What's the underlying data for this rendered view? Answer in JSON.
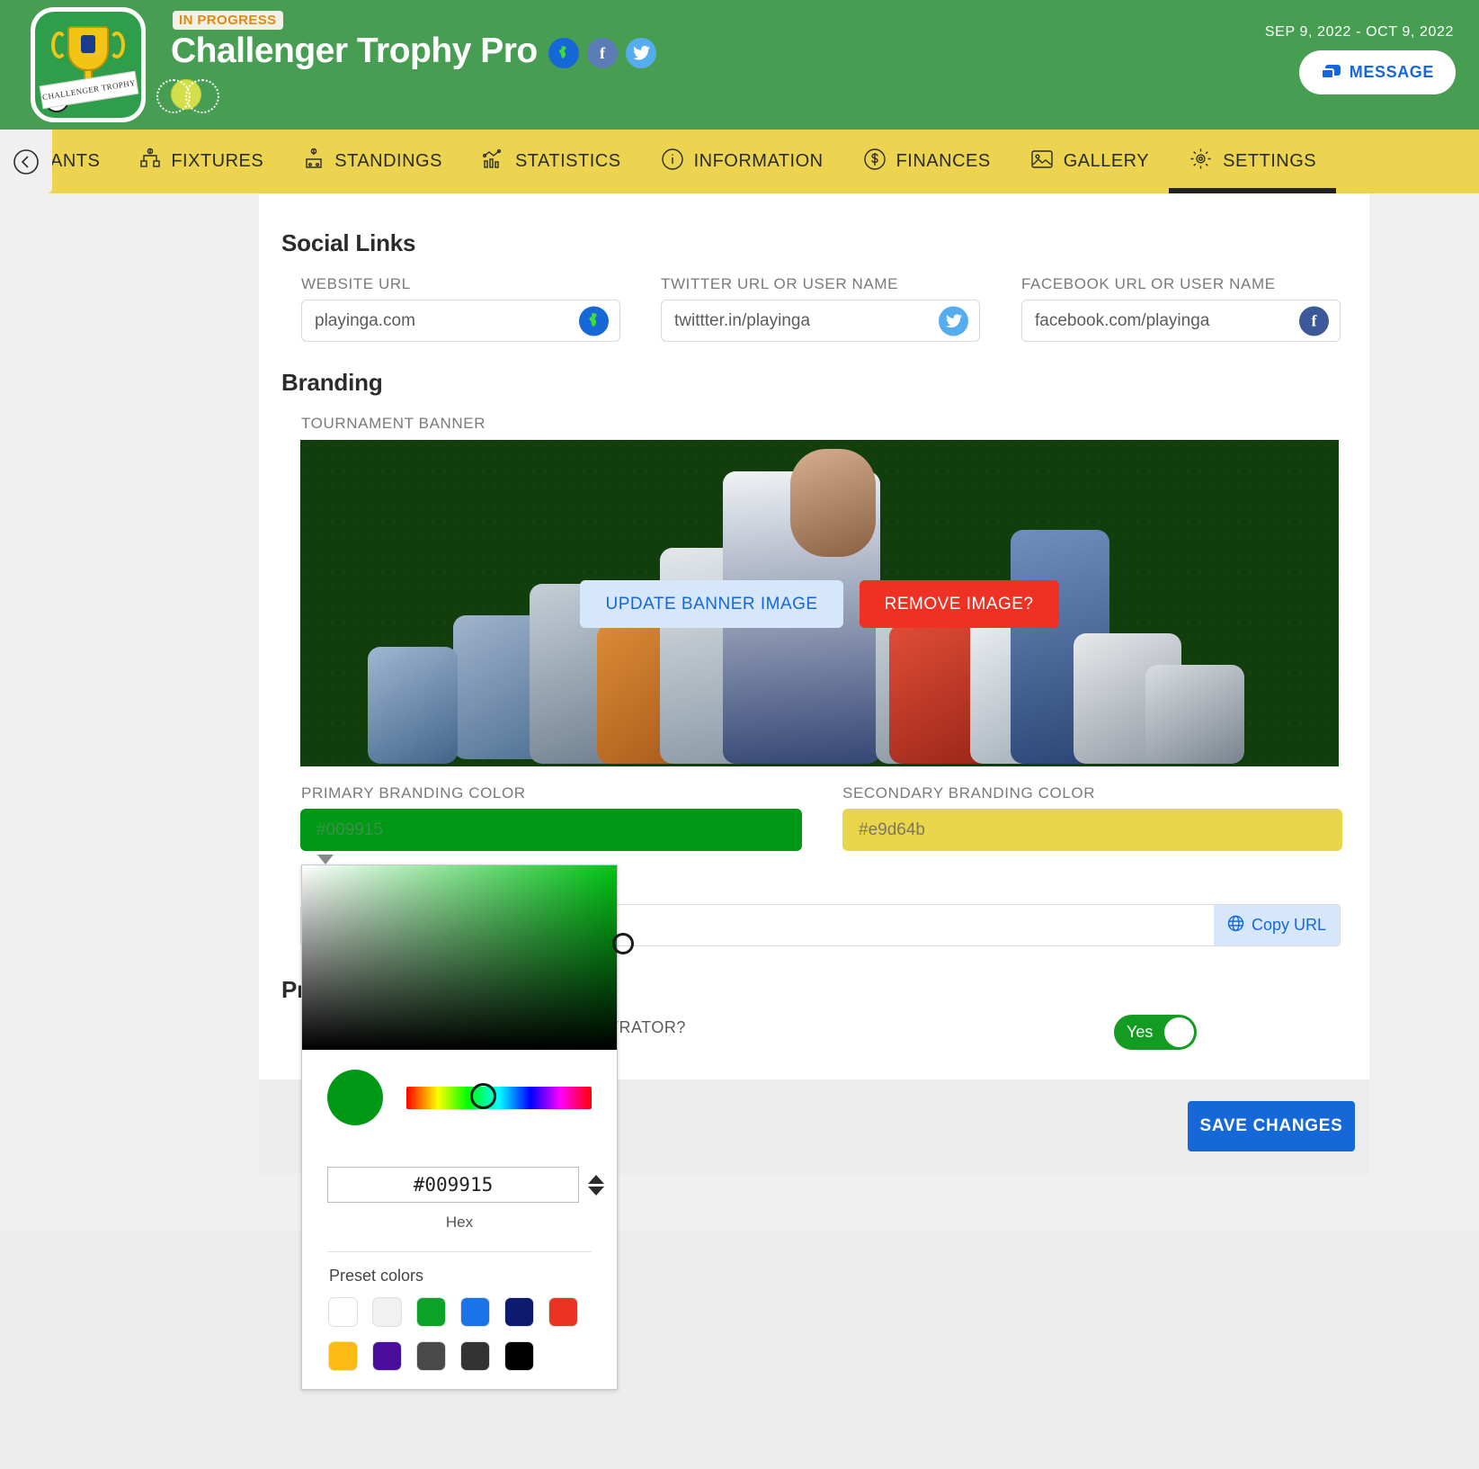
{
  "header": {
    "status_badge": "IN PROGRESS",
    "title": "Challenger Trophy Pro",
    "logo_ribbon_text": "CHALLENGER TROPHY",
    "date_range": "SEP 9, 2022 - OCT 9, 2022",
    "message_button": "MESSAGE",
    "social_icons": [
      "globe-icon",
      "facebook-icon",
      "twitter-icon"
    ]
  },
  "tabs": [
    {
      "label": "ANTS",
      "icon": "participants-icon",
      "active": false
    },
    {
      "label": "FIXTURES",
      "icon": "bracket-icon",
      "active": false
    },
    {
      "label": "STANDINGS",
      "icon": "podium-icon",
      "active": false
    },
    {
      "label": "STATISTICS",
      "icon": "chart-icon",
      "active": false
    },
    {
      "label": "INFORMATION",
      "icon": "info-icon",
      "active": false
    },
    {
      "label": "FINANCES",
      "icon": "dollar-icon",
      "active": false
    },
    {
      "label": "GALLERY",
      "icon": "image-icon",
      "active": false
    },
    {
      "label": "SETTINGS",
      "icon": "gear-icon",
      "active": true
    }
  ],
  "social_links": {
    "heading": "Social Links",
    "fields": [
      {
        "label": "WEBSITE URL",
        "value": "playinga.com",
        "icon": "globe-icon"
      },
      {
        "label": "TWITTER URL OR USER NAME",
        "value": "twittter.in/playinga",
        "icon": "twitter-icon"
      },
      {
        "label": "FACEBOOK URL OR USER NAME",
        "value": "facebook.com/playinga",
        "icon": "facebook-icon"
      }
    ]
  },
  "branding": {
    "heading": "Branding",
    "banner_label": "TOURNAMENT BANNER",
    "update_banner_button": "UPDATE BANNER IMAGE",
    "remove_image_button": "REMOVE IMAGE?",
    "primary_label": "PRIMARY BRANDING COLOR",
    "primary_value": "#009915",
    "secondary_label": "SECONDARY BRANDING COLOR",
    "secondary_value": "#e9d64b"
  },
  "url_row": {
    "value": "",
    "copy_button": "Copy URL"
  },
  "privacy": {
    "heading": "Pr",
    "question": "INISTRATOR?",
    "toggle_value": "Yes"
  },
  "footer": {
    "save_button": "SAVE CHANGES"
  },
  "color_picker": {
    "hex_value": "#009915",
    "hex_caption": "Hex",
    "preset_title": "Preset colors",
    "current_swatch": "#009915",
    "presets": [
      "#ffffff",
      "#f1f1f1",
      "#0ca227",
      "#1a73e8",
      "#0d1b6e",
      "#ea3323",
      "#fcbb14",
      "#4b0d9c",
      "#4a4a4a",
      "#333333",
      "#000000"
    ]
  }
}
